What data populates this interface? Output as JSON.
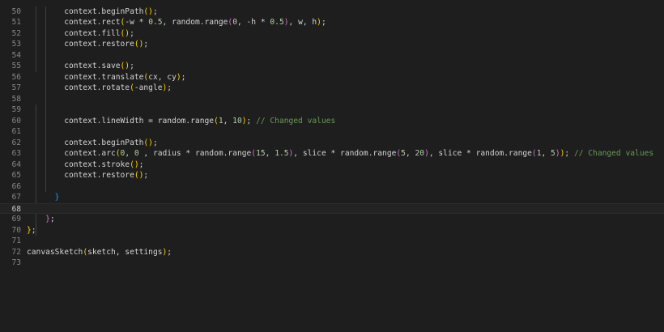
{
  "editor": {
    "theme": {
      "background": "#1e1e1e",
      "line_number": "#858585",
      "text": "#d4d4d4",
      "bracket_1": "#ffd700",
      "bracket_2": "#da70d6",
      "bracket_3": "#179fff",
      "number": "#b5cea8",
      "comment": "#6a9955"
    },
    "current_line": "68",
    "lines": [
      {
        "num": "50",
        "tokens": [
          {
            "t": "        context.beginPath",
            "c": "text"
          },
          {
            "t": "()",
            "c": "p1"
          },
          {
            "t": ";",
            "c": "text"
          }
        ]
      },
      {
        "num": "51",
        "tokens": [
          {
            "t": "        context.rect",
            "c": "text"
          },
          {
            "t": "(",
            "c": "p1"
          },
          {
            "t": "-w * ",
            "c": "text"
          },
          {
            "t": "0.5",
            "c": "num"
          },
          {
            "t": ", random.range",
            "c": "text"
          },
          {
            "t": "(",
            "c": "p2"
          },
          {
            "t": "0",
            "c": "num"
          },
          {
            "t": ", -h * ",
            "c": "text"
          },
          {
            "t": "0.5",
            "c": "num"
          },
          {
            "t": ")",
            "c": "p2"
          },
          {
            "t": ", w, h",
            "c": "text"
          },
          {
            "t": ")",
            "c": "p1"
          },
          {
            "t": ";",
            "c": "text"
          }
        ]
      },
      {
        "num": "52",
        "tokens": [
          {
            "t": "        context.fill",
            "c": "text"
          },
          {
            "t": "()",
            "c": "p1"
          },
          {
            "t": ";",
            "c": "text"
          }
        ]
      },
      {
        "num": "53",
        "tokens": [
          {
            "t": "        context.restore",
            "c": "text"
          },
          {
            "t": "()",
            "c": "p1"
          },
          {
            "t": ";",
            "c": "text"
          }
        ]
      },
      {
        "num": "54",
        "tokens": []
      },
      {
        "num": "55",
        "tokens": [
          {
            "t": "        context.save",
            "c": "text"
          },
          {
            "t": "()",
            "c": "p1"
          },
          {
            "t": ";",
            "c": "text"
          }
        ]
      },
      {
        "num": "56",
        "tokens": [
          {
            "t": "        context.translate",
            "c": "text"
          },
          {
            "t": "(",
            "c": "p1"
          },
          {
            "t": "cx, cy",
            "c": "text"
          },
          {
            "t": ")",
            "c": "p1"
          },
          {
            "t": ";",
            "c": "text"
          }
        ]
      },
      {
        "num": "57",
        "tokens": [
          {
            "t": "        context.rotate",
            "c": "text"
          },
          {
            "t": "(",
            "c": "p1"
          },
          {
            "t": "-angle",
            "c": "text"
          },
          {
            "t": ")",
            "c": "p1"
          },
          {
            "t": ";",
            "c": "text"
          }
        ]
      },
      {
        "num": "58",
        "tokens": []
      },
      {
        "num": "59",
        "tokens": []
      },
      {
        "num": "60",
        "tokens": [
          {
            "t": "        context.lineWidth = random.range",
            "c": "text"
          },
          {
            "t": "(",
            "c": "p1"
          },
          {
            "t": "1",
            "c": "num"
          },
          {
            "t": ", ",
            "c": "text"
          },
          {
            "t": "10",
            "c": "num"
          },
          {
            "t": ")",
            "c": "p1"
          },
          {
            "t": "; ",
            "c": "text"
          },
          {
            "t": "// Changed values",
            "c": "comment"
          }
        ]
      },
      {
        "num": "61",
        "tokens": []
      },
      {
        "num": "62",
        "tokens": [
          {
            "t": "        context.beginPath",
            "c": "text"
          },
          {
            "t": "()",
            "c": "p1"
          },
          {
            "t": ";",
            "c": "text"
          }
        ]
      },
      {
        "num": "63",
        "tokens": [
          {
            "t": "        context.arc",
            "c": "text"
          },
          {
            "t": "(",
            "c": "p1"
          },
          {
            "t": "0",
            "c": "num"
          },
          {
            "t": ", ",
            "c": "text"
          },
          {
            "t": "0",
            "c": "num"
          },
          {
            "t": " , radius * random.range",
            "c": "text"
          },
          {
            "t": "(",
            "c": "p2"
          },
          {
            "t": "15",
            "c": "num"
          },
          {
            "t": ", ",
            "c": "text"
          },
          {
            "t": "1.5",
            "c": "num"
          },
          {
            "t": ")",
            "c": "p2"
          },
          {
            "t": ", slice * random.range",
            "c": "text"
          },
          {
            "t": "(",
            "c": "p2"
          },
          {
            "t": "5",
            "c": "num"
          },
          {
            "t": ", ",
            "c": "text"
          },
          {
            "t": "20",
            "c": "num"
          },
          {
            "t": ")",
            "c": "p2"
          },
          {
            "t": ", slice * random.range",
            "c": "text"
          },
          {
            "t": "(",
            "c": "p2"
          },
          {
            "t": "1",
            "c": "num"
          },
          {
            "t": ", ",
            "c": "text"
          },
          {
            "t": "5",
            "c": "num"
          },
          {
            "t": ")",
            "c": "p2"
          },
          {
            "t": ")",
            "c": "p1"
          },
          {
            "t": "; ",
            "c": "text"
          },
          {
            "t": "// Changed values",
            "c": "comment"
          }
        ]
      },
      {
        "num": "64",
        "tokens": [
          {
            "t": "        context.stroke",
            "c": "text"
          },
          {
            "t": "()",
            "c": "p1"
          },
          {
            "t": ";",
            "c": "text"
          }
        ]
      },
      {
        "num": "65",
        "tokens": [
          {
            "t": "        context.restore",
            "c": "text"
          },
          {
            "t": "()",
            "c": "p1"
          },
          {
            "t": ";",
            "c": "text"
          }
        ]
      },
      {
        "num": "66",
        "tokens": []
      },
      {
        "num": "67",
        "tokens": [
          {
            "t": "      ",
            "c": "text"
          },
          {
            "t": "}",
            "c": "p3"
          }
        ]
      },
      {
        "num": "68",
        "tokens": []
      },
      {
        "num": "69",
        "tokens": [
          {
            "t": "    ",
            "c": "text"
          },
          {
            "t": "}",
            "c": "p2"
          },
          {
            "t": ";",
            "c": "text"
          }
        ]
      },
      {
        "num": "70",
        "tokens": [
          {
            "t": "}",
            "c": "p1"
          },
          {
            "t": ";",
            "c": "text"
          }
        ]
      },
      {
        "num": "71",
        "tokens": []
      },
      {
        "num": "72",
        "tokens": [
          {
            "t": "canvasSketch",
            "c": "text"
          },
          {
            "t": "(",
            "c": "p1"
          },
          {
            "t": "sketch, settings",
            "c": "text"
          },
          {
            "t": ")",
            "c": "p1"
          },
          {
            "t": ";",
            "c": "text"
          }
        ]
      },
      {
        "num": "73",
        "tokens": []
      }
    ]
  }
}
